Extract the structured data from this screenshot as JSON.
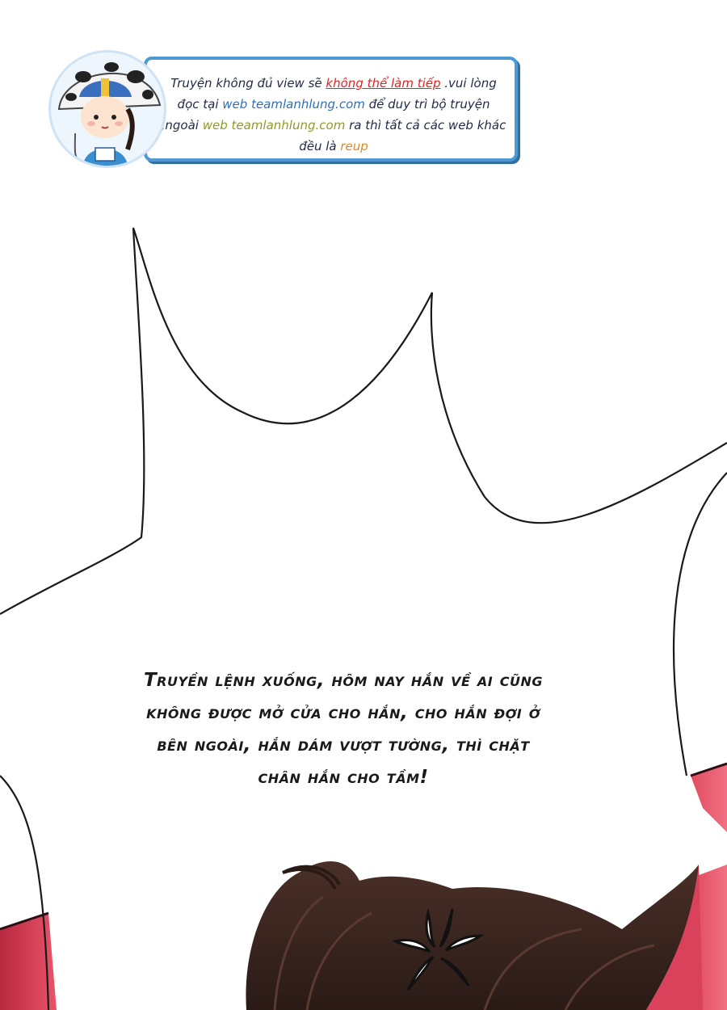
{
  "banner": {
    "segments": [
      {
        "text": "Truyện không đủ view sẽ ",
        "style": "normal"
      },
      {
        "text": "không thể làm tiếp",
        "style": "red"
      },
      {
        "text": " .vui lòng đọc tại ",
        "style": "normal"
      },
      {
        "text": "web teamlanhlung.com",
        "style": "blue"
      },
      {
        "text": " để duy trì bộ truyện ,ngoài ",
        "style": "normal"
      },
      {
        "text": "web teamlanhlung.com",
        "style": "olive"
      },
      {
        "text": " ra thì tất cả các web khác đều là ",
        "style": "normal"
      },
      {
        "text": "reup",
        "style": "orange"
      }
    ],
    "avatar_icon": "chibi-mascot-with-umbrella"
  },
  "dialog": {
    "lines": [
      "Truyền lệnh xuống, hôm nay hắn về ai cũng",
      "không được mở cửa cho hắn, cho hắn đợi ở",
      "bên ngoài, hắn dám vượt tường, thì chặt",
      "chân hắn cho tầm!"
    ]
  },
  "colors": {
    "banner_border": "#4d9ad2",
    "hair": "#3a2620",
    "side_panel": "#d9425a",
    "anger_mark": "#ffffff"
  },
  "icons": {
    "anger": "anger-mark-icon"
  }
}
